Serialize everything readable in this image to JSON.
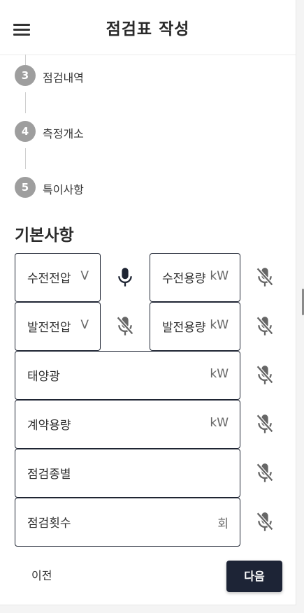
{
  "header": {
    "title": "점검표 작성"
  },
  "steps": [
    {
      "number": "3",
      "label": "점검내역"
    },
    {
      "number": "4",
      "label": "측정개소"
    },
    {
      "number": "5",
      "label": "특이사항"
    }
  ],
  "section": {
    "title": "기본사항"
  },
  "fields": {
    "receive_voltage": {
      "label": "수전전압",
      "unit": "V"
    },
    "receive_capacity": {
      "label": "수전용량",
      "unit": "kW"
    },
    "gen_voltage": {
      "label": "발전전압",
      "unit": "V"
    },
    "gen_capacity": {
      "label": "발전용량",
      "unit": "kW"
    },
    "solar": {
      "label": "태양광",
      "unit": "kW"
    },
    "contract_capacity": {
      "label": "계약용량",
      "unit": "kW"
    },
    "inspection_type": {
      "label": "점검종별",
      "unit": ""
    },
    "inspection_count": {
      "label": "점검횟수",
      "unit": "회"
    }
  },
  "icons": {
    "active_mic": "microphone-icon",
    "muted_mic": "microphone-off-icon",
    "menu": "hamburger-menu-icon"
  },
  "footer": {
    "prev_label": "이전",
    "next_label": "다음"
  },
  "colors": {
    "primary": "#1d2436",
    "step_circle": "#9e9e9e",
    "border": "#1f2533"
  }
}
